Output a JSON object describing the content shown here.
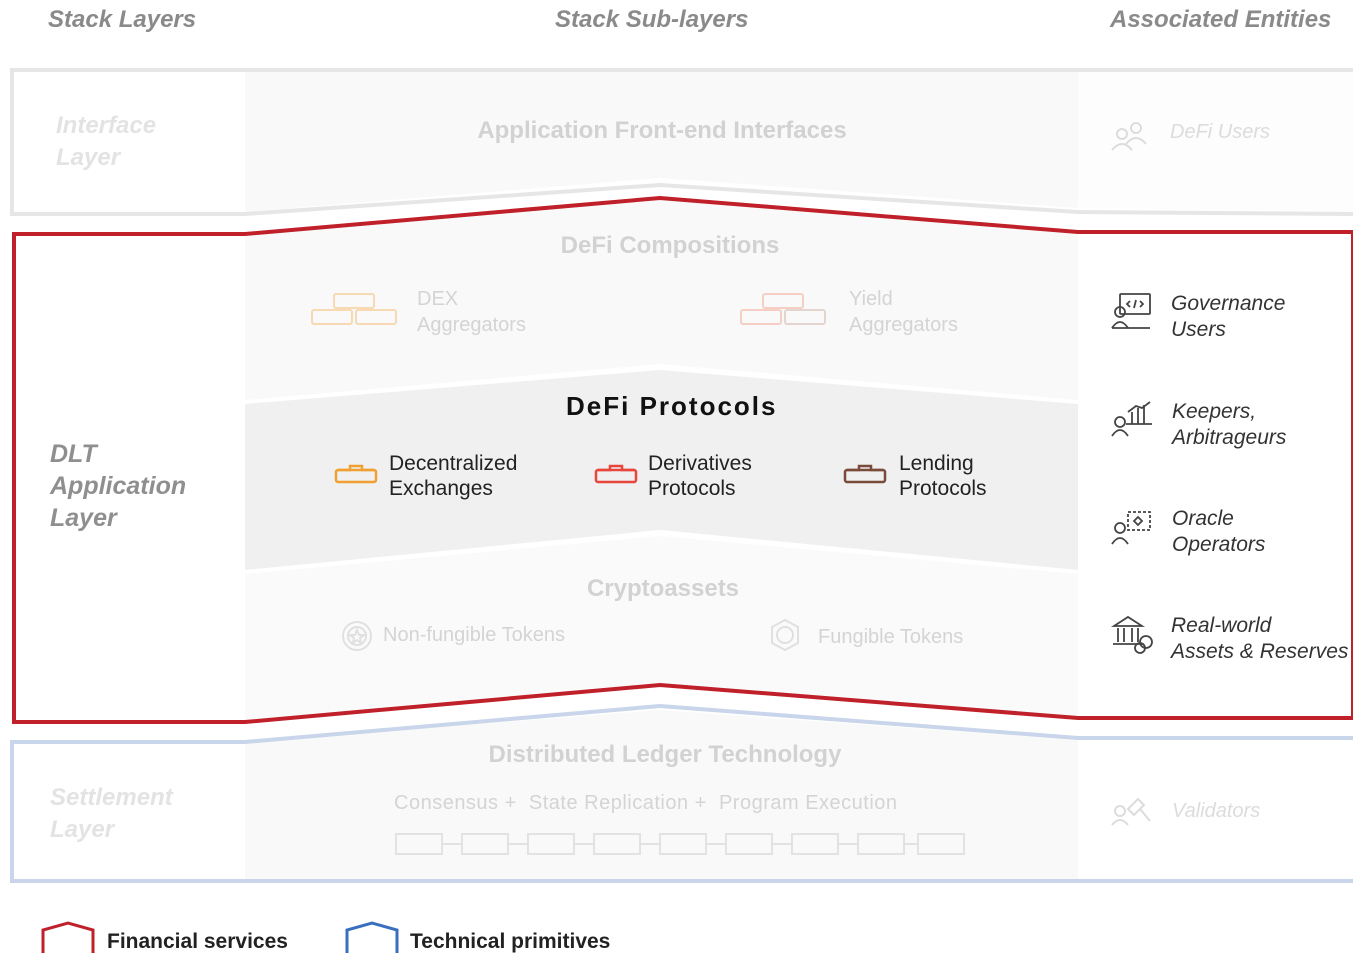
{
  "headers": {
    "stack_layers": "Stack Layers",
    "stack_sub_layers": "Stack Sub-layers",
    "associated_entities": "Associated Entities"
  },
  "interface_layer": {
    "label_line1": "Interface",
    "label_line2": "Layer",
    "sublayer": "Application Front-end Interfaces",
    "entity": "DeFi Users"
  },
  "dlt_application_layer": {
    "label_line1": "DLT",
    "label_line2": "Application",
    "label_line3": "Layer",
    "compositions": {
      "title": "DeFi Compositions",
      "items": [
        {
          "line1": "DEX",
          "line2": "Aggregators"
        },
        {
          "line1": "Yield",
          "line2": "Aggregators"
        }
      ]
    },
    "protocols": {
      "title": "DeFi Protocols",
      "items": [
        {
          "line1": "Decentralized",
          "line2": "Exchanges",
          "color": "#f0a030"
        },
        {
          "line1": "Derivatives",
          "line2": "Protocols",
          "color": "#e8453c"
        },
        {
          "line1": "Lending",
          "line2": "Protocols",
          "color": "#7a4a3a"
        }
      ]
    },
    "cryptoassets": {
      "title": "Cryptoassets",
      "items": [
        "Non-fungible Tokens",
        "Fungible Tokens"
      ]
    },
    "entities": [
      {
        "line1": "Governance",
        "line2": "Users",
        "icon": "governance-user-icon"
      },
      {
        "line1": "Keepers,",
        "line2": "Arbitrageurs",
        "icon": "keeper-chart-icon"
      },
      {
        "line1": "Oracle",
        "line2": "Operators",
        "icon": "oracle-operator-icon"
      },
      {
        "line1": "Real-world",
        "line2": "Assets & Reserves",
        "icon": "bank-assets-icon"
      }
    ]
  },
  "settlement_layer": {
    "label_line1": "Settlement",
    "label_line2": "Layer",
    "sublayer": "Distributed Ledger Technology",
    "components": "Consensus +  State Replication +  Program Execution",
    "entity": "Validators"
  },
  "legend": {
    "financial": "Financial services",
    "technical": "Technical primitives"
  },
  "colors": {
    "financial_border": "#c0202a",
    "technical_border": "#c5d3ea",
    "interface_border": "#e8e8e8"
  }
}
